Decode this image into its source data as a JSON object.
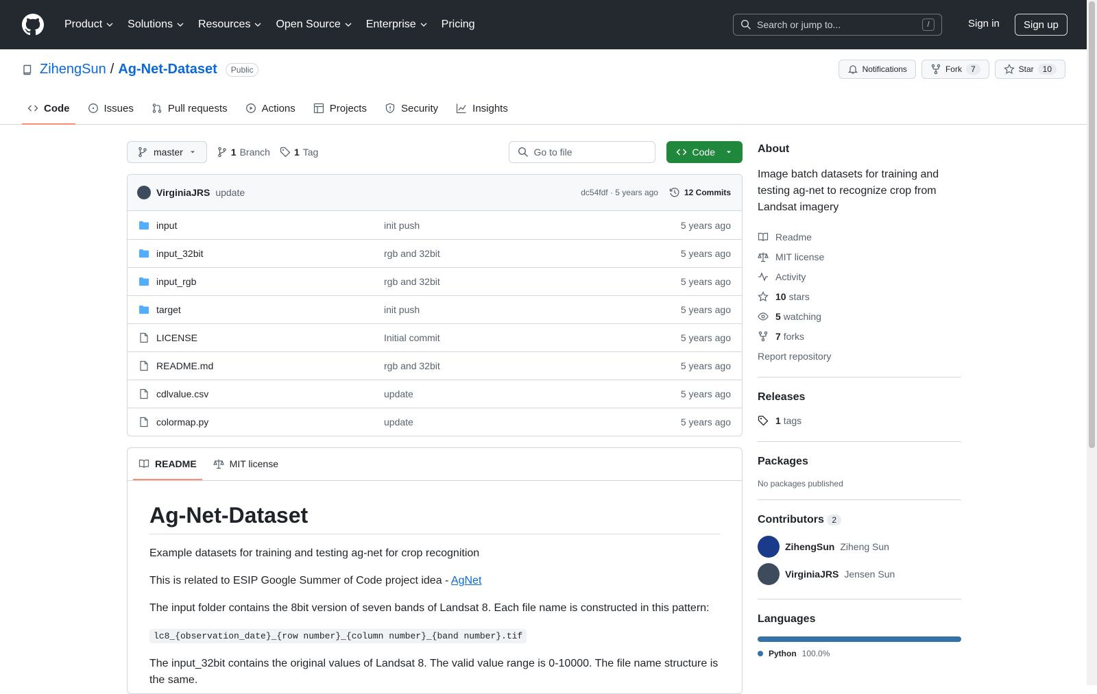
{
  "nav": {
    "items": [
      "Product",
      "Solutions",
      "Resources",
      "Open Source",
      "Enterprise",
      "Pricing"
    ],
    "search_placeholder": "Search or jump to...",
    "slash": "/",
    "signin": "Sign in",
    "signup": "Sign up"
  },
  "repo": {
    "owner": "ZihengSun",
    "sep": "/",
    "name": "Ag-Net-Dataset",
    "visibility": "Public",
    "notifications": "Notifications",
    "fork": "Fork",
    "fork_count": "7",
    "star": "Star",
    "star_count": "10"
  },
  "tabs": [
    "Code",
    "Issues",
    "Pull requests",
    "Actions",
    "Projects",
    "Security",
    "Insights"
  ],
  "toolbar": {
    "branch": "master",
    "branches_num": "1",
    "branches_label": "Branch",
    "tags_num": "1",
    "tags_label": "Tag",
    "gofile": "Go to file",
    "code": "Code"
  },
  "commit": {
    "author": "VirginiaJRS",
    "message": "update",
    "hash": "dc54fdf · 5 years ago",
    "count": "12 Commits"
  },
  "files": [
    {
      "name": "input",
      "msg": "init push",
      "age": "5 years ago",
      "type": "dir"
    },
    {
      "name": "input_32bit",
      "msg": "rgb and 32bit",
      "age": "5 years ago",
      "type": "dir"
    },
    {
      "name": "input_rgb",
      "msg": "rgb and 32bit",
      "age": "5 years ago",
      "type": "dir"
    },
    {
      "name": "target",
      "msg": "init push",
      "age": "5 years ago",
      "type": "dir"
    },
    {
      "name": "LICENSE",
      "msg": "Initial commit",
      "age": "5 years ago",
      "type": "file"
    },
    {
      "name": "README.md",
      "msg": "rgb and 32bit",
      "age": "5 years ago",
      "type": "file"
    },
    {
      "name": "cdlvalue.csv",
      "msg": "update",
      "age": "5 years ago",
      "type": "file"
    },
    {
      "name": "colormap.py",
      "msg": "update",
      "age": "5 years ago",
      "type": "file"
    }
  ],
  "readme": {
    "tab_readme": "README",
    "tab_license": "MIT license",
    "title": "Ag-Net-Dataset",
    "p1": "Example datasets for training and testing ag-net for crop recognition",
    "p2": "This is related to ESIP Google Summer of Code project idea - ",
    "p2_link": "AgNet",
    "p3": "The input folder contains the 8bit version of seven bands of Landsat 8. Each file name is constructed in this pattern:",
    "code": "lc8_{observation_date}_{row number}_{column number}_{band number}.tif",
    "p4": "The input_32bit contains the original values of Landsat 8. The valid value range is 0-10000. The file name structure is the same."
  },
  "about": {
    "title": "About",
    "desc": "Image batch datasets for training and testing ag-net to recognize crop from Landsat imagery",
    "readme": "Readme",
    "license": "MIT license",
    "activity": "Activity",
    "stars_num": "10",
    "stars": "stars",
    "watching_num": "5",
    "watching": "watching",
    "forks_num": "7",
    "forks": "forks",
    "report": "Report repository"
  },
  "releases": {
    "title": "Releases",
    "tags_num": "1",
    "tags": "tags"
  },
  "packages": {
    "title": "Packages",
    "none": "No packages published"
  },
  "contributors": {
    "title": "Contributors",
    "count": "2",
    "list": [
      {
        "login": "ZihengSun",
        "name": "Ziheng Sun"
      },
      {
        "login": "VirginiaJRS",
        "name": "Jensen Sun"
      }
    ]
  },
  "languages": {
    "title": "Languages",
    "name": "Python",
    "pct": "100.0%",
    "color": "#3572A5"
  }
}
